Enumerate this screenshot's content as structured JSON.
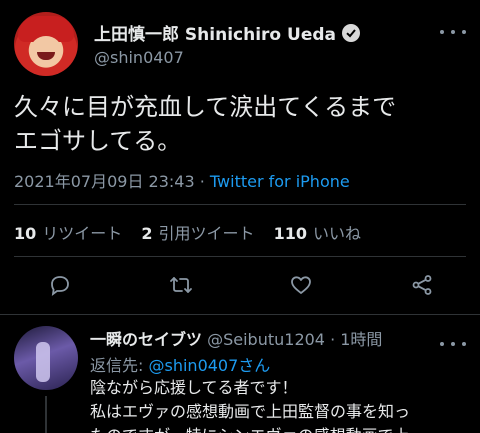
{
  "tweet": {
    "author_name": "上田慎一郎 Shinichiro Ueda",
    "author_handle": "@shin0407",
    "text_line1": "久々に目が充血して涙出てくるまで",
    "text_line2": "エゴサしてる。",
    "datetime": "2021年07月09日 23:43",
    "separator": " · ",
    "source_app": "Twitter for iPhone",
    "stats": {
      "retweets_count": "10",
      "retweets_label": "リツイート",
      "quotes_count": "2",
      "quotes_label": "引用ツイート",
      "likes_count": "110",
      "likes_label": "いいね"
    }
  },
  "actions": {
    "reply_icon": "reply-icon",
    "retweet_icon": "retweet-icon",
    "like_icon": "heart-icon",
    "share_icon": "share-icon"
  },
  "reply": {
    "author_name": "一瞬のセイブツ",
    "author_handle": "@Seibutu1204",
    "time": "· 1時間",
    "reply_to_label": "返信先:",
    "reply_to_target": "@shin0407さん",
    "text_line1": "陰ながら応援してる者です！",
    "text_line2": "私はエヴァの感想動画で上田監督の事を知っ",
    "text_line3": "たのですが、特にシンエヴァの感想動画で上"
  },
  "colors": {
    "background": "#000000",
    "text": "#e7e9ea",
    "secondary": "#8b98a5",
    "link": "#1d9bf0",
    "divider": "#2f3336"
  }
}
